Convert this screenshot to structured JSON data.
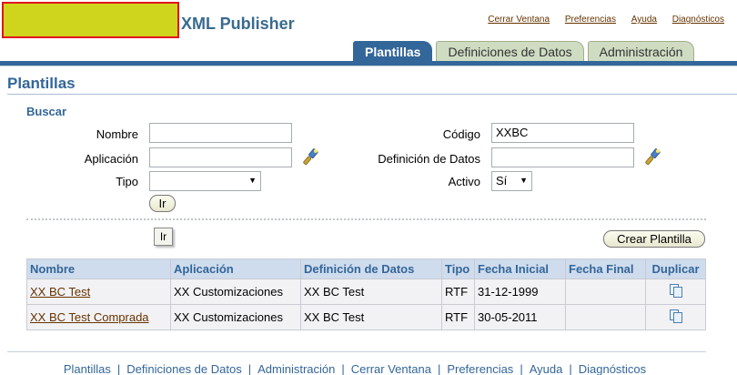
{
  "header": {
    "app_title": "XML Publisher",
    "global_links": [
      "Cerrar Ventana",
      "Preferencias",
      "Ayuda",
      "Diagnósticos"
    ]
  },
  "tabs": [
    {
      "label": "Plantillas",
      "active": true
    },
    {
      "label": "Definiciones de Datos",
      "active": false
    },
    {
      "label": "Administración",
      "active": false
    }
  ],
  "page": {
    "title": "Plantillas"
  },
  "search": {
    "title": "Buscar",
    "nombre_label": "Nombre",
    "nombre_value": "",
    "aplicacion_label": "Aplicación",
    "aplicacion_value": "",
    "tipo_label": "Tipo",
    "tipo_value": "",
    "codigo_label": "Código",
    "codigo_value": "XXBC",
    "definicion_label": "Definición de Datos",
    "definicion_value": "",
    "activo_label": "Activo",
    "activo_value": "Sí",
    "go_button": "Ir",
    "go_button2": "Ir"
  },
  "actions": {
    "create_button": "Crear Plantilla"
  },
  "table": {
    "headers": [
      "Nombre",
      "Aplicación",
      "Definición de Datos",
      "Tipo",
      "Fecha Inicial",
      "Fecha Final",
      "Duplicar"
    ],
    "rows": [
      {
        "nombre": "XX BC Test",
        "aplicacion": "XX Customizaciones",
        "definicion": "XX BC Test",
        "tipo": "RTF",
        "fecha_inicial": "31-12-1999",
        "fecha_final": ""
      },
      {
        "nombre": "XX BC Test Comprada",
        "aplicacion": "XX Customizaciones",
        "definicion": "XX BC Test",
        "tipo": "RTF",
        "fecha_inicial": "30-05-2011",
        "fecha_final": ""
      }
    ]
  },
  "footer": {
    "links": [
      "Plantillas",
      "Definiciones de Datos",
      "Administración",
      "Cerrar Ventana",
      "Preferencias",
      "Ayuda",
      "Diagnósticos"
    ]
  },
  "colors": {
    "brand_blue": "#336699",
    "link_brown": "#663300",
    "logo_fill": "#cfd41c",
    "logo_border": "#e0141b"
  }
}
